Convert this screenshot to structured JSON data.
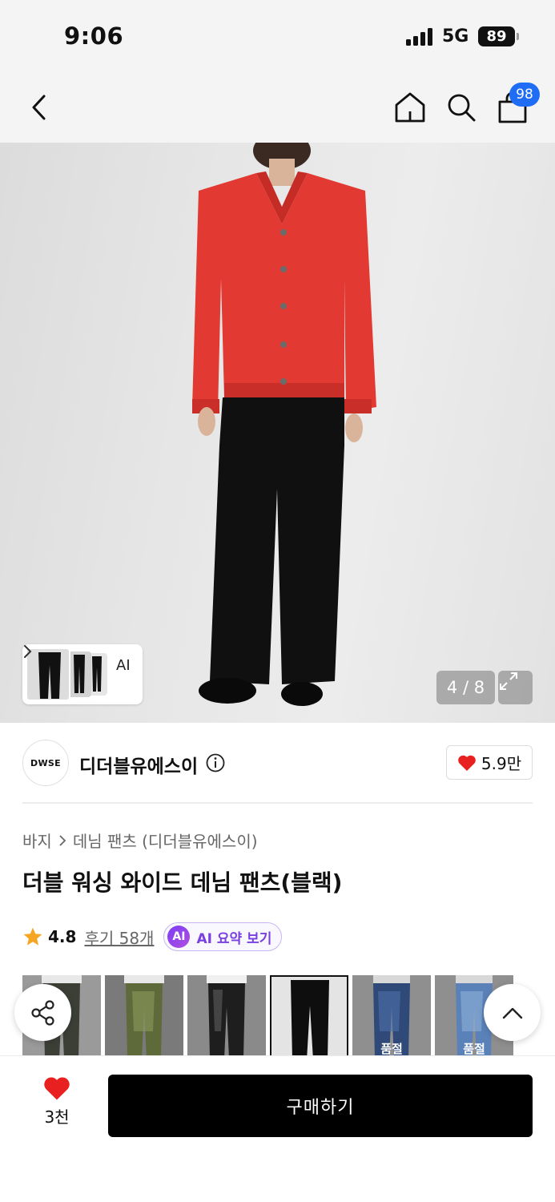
{
  "status_bar": {
    "time": "9:06",
    "network": "5G",
    "battery": "89"
  },
  "header": {
    "cart_badge": "98",
    "icons": [
      "back-icon",
      "home-icon",
      "search-icon",
      "cart-icon"
    ]
  },
  "hero": {
    "ai_label": "AI",
    "counter": "4 / 8",
    "current_image": 4,
    "total_images": 8
  },
  "brand": {
    "logo_text": "DWSE",
    "name": "디더블유에스이",
    "like_count": "5.9만"
  },
  "product": {
    "breadcrumb": [
      "바지",
      "데님 팬츠 (디더블유에스이)"
    ],
    "title": "더블 워싱 와이드 데님 팬츠(블랙)",
    "rating": "4.8",
    "review_link": "후기 58개",
    "ai_badge": "AI",
    "ai_summary_label": "AI 요약 보기"
  },
  "thumbnails": [
    {
      "selected": false,
      "label": ""
    },
    {
      "selected": false,
      "label": ""
    },
    {
      "selected": false,
      "label": ""
    },
    {
      "selected": true,
      "label": ""
    },
    {
      "selected": false,
      "label": "품절"
    },
    {
      "selected": false,
      "label": "품절"
    }
  ],
  "bottom_bar": {
    "wish_count": "3천",
    "buy_label": "구매하기"
  },
  "colors": {
    "accent_blue": "#1f6cf5",
    "heart_red": "#e8201f",
    "star_orange": "#f5a623",
    "ai_purple": "#7a3fe0",
    "buy_button": "#000000"
  }
}
